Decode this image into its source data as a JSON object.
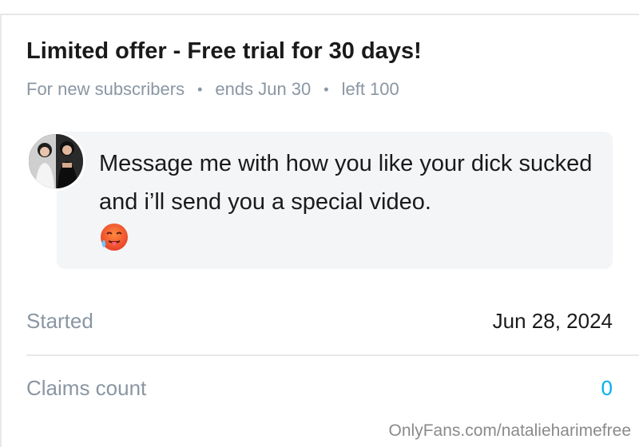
{
  "offer": {
    "title": "Limited offer - Free trial for 30 days!",
    "audience": "For new subscribers",
    "separator": "•",
    "ends": "ends Jun 30",
    "left": "left 100"
  },
  "message": {
    "text": "Message me with how you like your dick sucked and i’ll send you a special video.",
    "emoji_icon": "hot-face-emoji"
  },
  "details": {
    "started_label": "Started",
    "started_value": "Jun 28, 2024",
    "claims_label": "Claims count",
    "claims_value": "0"
  },
  "watermark": "OnlyFans.com/natalieharimefree",
  "colors": {
    "accent": "#00aff0",
    "muted": "#8a96a3",
    "bubble": "#f3f5f7"
  }
}
